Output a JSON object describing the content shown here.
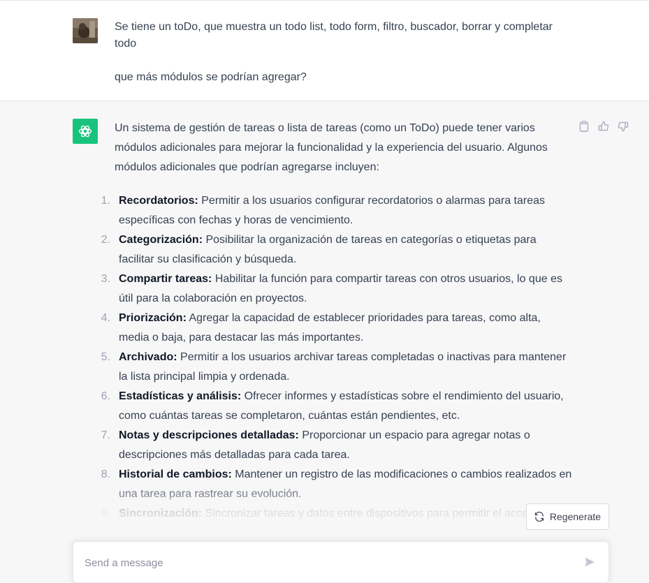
{
  "user_message": {
    "line1": "Se tiene un toDo, que muestra un todo list, todo form, filtro, buscador, borrar y completar todo",
    "line2": "que más módulos se podrían agregar?"
  },
  "assistant_message": {
    "intro": "Un sistema de gestión de tareas o lista de tareas (como un ToDo) puede tener varios módulos adicionales para mejorar la funcionalidad y la experiencia del usuario. Algunos módulos adicionales que podrían agregarse incluyen:",
    "items": [
      {
        "num": "1.",
        "title": "Recordatorios:",
        "text": " Permitir a los usuarios configurar recordatorios o alarmas para tareas específicas con fechas y horas de vencimiento."
      },
      {
        "num": "2.",
        "title": "Categorización:",
        "text": " Posibilitar la organización de tareas en categorías o etiquetas para facilitar su clasificación y búsqueda."
      },
      {
        "num": "3.",
        "title": "Compartir tareas:",
        "text": " Habilitar la función para compartir tareas con otros usuarios, lo que es útil para la colaboración en proyectos."
      },
      {
        "num": "4.",
        "title": "Priorización:",
        "text": " Agregar la capacidad de establecer prioridades para tareas, como alta, media o baja, para destacar las más importantes."
      },
      {
        "num": "5.",
        "title": "Archivado:",
        "text": " Permitir a los usuarios archivar tareas completadas o inactivas para mantener la lista principal limpia y ordenada."
      },
      {
        "num": "6.",
        "title": "Estadísticas y análisis:",
        "text": " Ofrecer informes y estadísticas sobre el rendimiento del usuario, como cuántas tareas se completaron, cuántas están pendientes, etc."
      },
      {
        "num": "7.",
        "title": "Notas y descripciones detalladas:",
        "text": " Proporcionar un espacio para agregar notas o descripciones más detalladas para cada tarea."
      },
      {
        "num": "8.",
        "title": "Historial de cambios:",
        "text": " Mantener un registro de las modificaciones o cambios realizados en una tarea para rastrear su evolución."
      },
      {
        "num": "9.",
        "title": "Sincronización:",
        "text": " Sincronizar tareas y datos entre dispositivos para permitir el acceso desde diferentes plataformas, como dispositivos móviles y computadoras."
      }
    ],
    "actions": {
      "copy_icon": "clipboard-icon",
      "like_icon": "thumbs-up-icon",
      "dislike_icon": "thumbs-down-icon"
    }
  },
  "regenerate_label": "Regenerate",
  "composer": {
    "placeholder": "Send a message"
  },
  "colors": {
    "assistant_bg": "#f7f7f8",
    "gpt_green": "#19c37d",
    "text": "#374151"
  }
}
